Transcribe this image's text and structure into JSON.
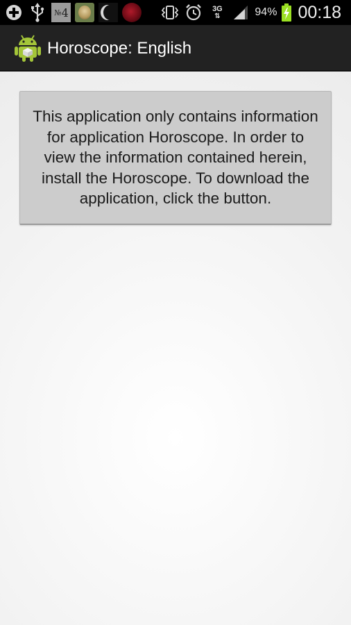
{
  "status_bar": {
    "left_icons": [
      "add-icon",
      "usb-icon",
      "no4-icon",
      "face-icon",
      "moon-icon",
      "rose-icon"
    ],
    "no4_prefix": "№",
    "no4_digit": "4",
    "network_type": "3G",
    "battery_percent": "94%",
    "time": "00:18"
  },
  "action_bar": {
    "title": "Horoscope: English",
    "icon": "android-icon"
  },
  "main": {
    "info_button_text": "This application only contains information for application Horoscope. In order to view the information contained herein, install the Horoscope. To download the application, click the button."
  },
  "colors": {
    "status_bar_bg": "#000000",
    "action_bar_bg": "#222222",
    "button_bg": "#cccccc",
    "android_green": "#a4c639",
    "battery_green": "#9be023"
  }
}
